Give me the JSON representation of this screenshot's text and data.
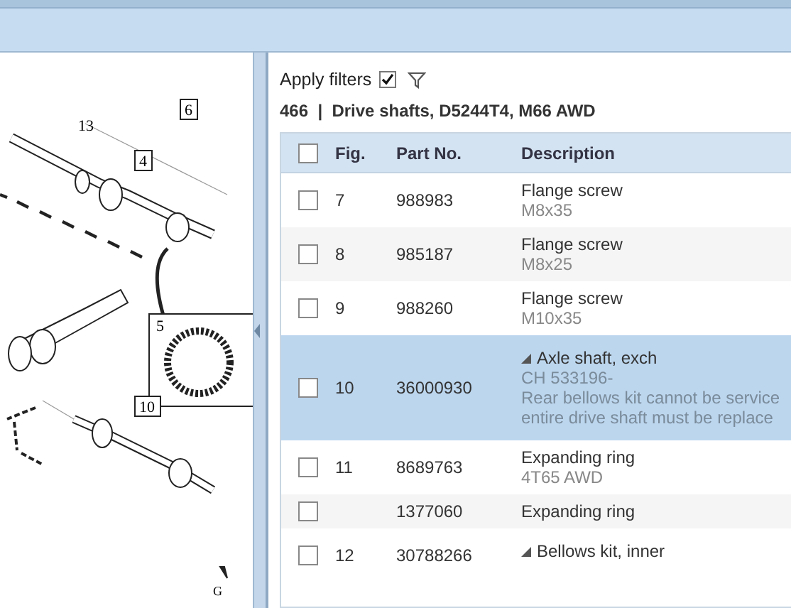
{
  "diagram": {
    "labels": [
      {
        "text": "13",
        "boxed": false
      },
      {
        "text": "4",
        "boxed": true
      },
      {
        "text": "6",
        "boxed": true
      },
      {
        "text": "5",
        "boxed": false
      },
      {
        "text": "10",
        "boxed": true
      },
      {
        "text": "G",
        "boxed": false
      }
    ]
  },
  "filters": {
    "label": "Apply filters",
    "checked": true
  },
  "title": "466  |  Drive shafts, D5244T4, M66 AWD",
  "table": {
    "columns": [
      "Fig.",
      "Part No.",
      "Description"
    ],
    "select_all": false,
    "rows": [
      {
        "kind": "part",
        "fig": "7",
        "part_no": "988983",
        "description": "Flange screw",
        "notes": [
          "M8x35"
        ],
        "checked": false,
        "selected": false
      },
      {
        "kind": "part",
        "fig": "8",
        "part_no": "985187",
        "description": "Flange screw",
        "notes": [
          "M8x25"
        ],
        "checked": false,
        "selected": false
      },
      {
        "kind": "part",
        "fig": "9",
        "part_no": "988260",
        "description": "Flange screw",
        "notes": [
          "M10x35"
        ],
        "checked": false,
        "selected": false
      },
      {
        "kind": "group",
        "expanded": true,
        "fig": "10",
        "part_no": "36000930",
        "description": "Axle shaft, exch",
        "notes": [
          "CH 533196-",
          "Rear bellows kit cannot be service",
          "entire drive shaft must be replace"
        ],
        "checked": false,
        "selected": true
      },
      {
        "kind": "part",
        "fig": "11",
        "part_no": "8689763",
        "description": "Expanding ring",
        "notes": [
          "4T65 AWD"
        ],
        "checked": false,
        "selected": false
      },
      {
        "kind": "part",
        "fig": "",
        "part_no": "1377060",
        "description": "Expanding ring",
        "notes": [],
        "checked": false,
        "selected": false
      },
      {
        "kind": "group",
        "expanded": true,
        "fig": "12",
        "part_no": "30788266",
        "description": "Bellows kit, inner",
        "notes": [],
        "checked": false,
        "selected": false
      }
    ]
  }
}
